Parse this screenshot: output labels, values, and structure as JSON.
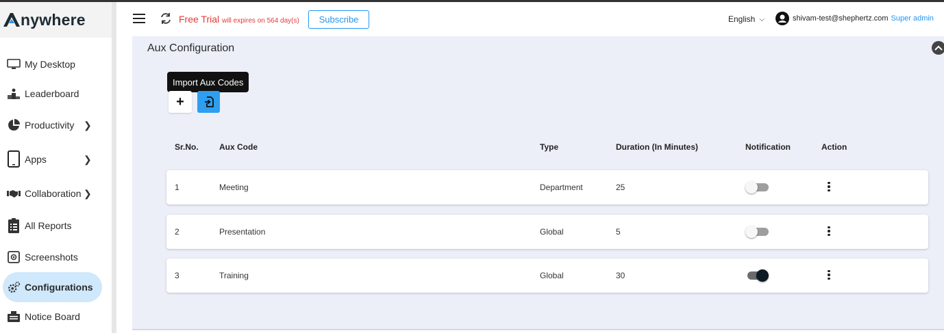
{
  "app": {
    "logo_text": "nywhere"
  },
  "sidebar": {
    "items": [
      {
        "label": "My Desktop",
        "icon": "monitor-icon",
        "has_chevron": false
      },
      {
        "label": "Leaderboard",
        "icon": "podium-icon",
        "has_chevron": false
      },
      {
        "label": "Productivity",
        "icon": "pie-chart-icon",
        "has_chevron": true
      },
      {
        "label": "Apps",
        "icon": "tablet-icon",
        "has_chevron": true
      },
      {
        "label": "Collaboration",
        "icon": "handshake-icon",
        "has_chevron": true
      },
      {
        "label": "All Reports",
        "icon": "clipboard-list-icon",
        "has_chevron": false
      },
      {
        "label": "Screenshots",
        "icon": "screenshot-icon",
        "has_chevron": false
      },
      {
        "label": "Configurations",
        "icon": "gear-icon",
        "has_chevron": false,
        "active": true
      },
      {
        "label": "Notice Board",
        "icon": "notice-board-icon",
        "has_chevron": false
      }
    ]
  },
  "header": {
    "trial_label": "Free Trial",
    "trial_expiry": "will expires on 564 day(s)",
    "subscribe_label": "Subscribe",
    "language": "English",
    "user_email": "shivam-test@shephertz.com",
    "user_role": "Super admin"
  },
  "section": {
    "title": "Aux Configuration",
    "tooltip": "Import Aux Codes",
    "add_label": "+"
  },
  "table": {
    "headers": {
      "sr": "Sr.No.",
      "code": "Aux Code",
      "type": "Type",
      "duration": "Duration (In Minutes)",
      "notification": "Notification",
      "action": "Action"
    },
    "rows": [
      {
        "sr": "1",
        "code": "Meeting",
        "type": "Department",
        "duration": "25",
        "notification": false
      },
      {
        "sr": "2",
        "code": "Presentation",
        "type": "Global",
        "duration": "5",
        "notification": false
      },
      {
        "sr": "3",
        "code": "Training",
        "type": "Global",
        "duration": "30",
        "notification": true
      }
    ]
  },
  "colors": {
    "accent": "#2196f3",
    "trial": "#e53935",
    "active_nav": "#cfe8fb",
    "main_bg": "#eceff8"
  }
}
